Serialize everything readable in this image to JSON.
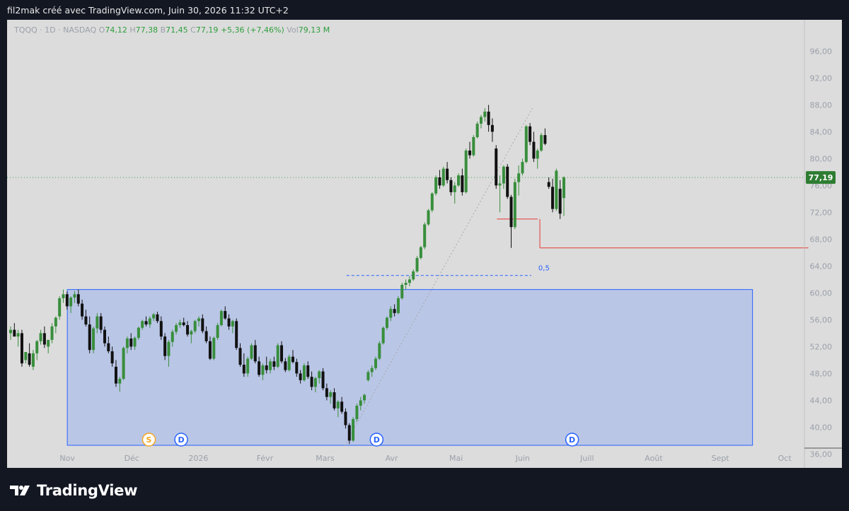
{
  "header": {
    "title": "fil2mak créé avec TradingView.com, Juin 30, 2026 11:32 UTC+2"
  },
  "legend": {
    "symbol": "TQQQ · 1D · NASDAQ",
    "o_label": "O",
    "o_value": "74,12",
    "h_label": "H",
    "h_value": "77,38",
    "l_label": "B",
    "l_value": "71,45",
    "c_label": "C",
    "c_value": "77,19",
    "change": "+5,36 (+7,46%)",
    "vol_label": "Vol",
    "vol_value": "79,13 M"
  },
  "price_label": "77,19",
  "fib_label": "0,5",
  "brand": {
    "name": "TradingView"
  },
  "colors": {
    "up": "#388e3c",
    "down": "#111111",
    "zone_fill": "#b7c4e6",
    "zone_stroke": "#2962ff",
    "support": "#e53935",
    "last_price": "#2e7d32"
  },
  "chart_data": {
    "type": "candlestick",
    "symbol": "TQQQ",
    "interval": "1D",
    "exchange": "NASDAQ",
    "ylim": [
      34,
      98
    ],
    "y_ticks": [
      "96,00",
      "92,00",
      "88,00",
      "84,00",
      "80,00",
      "76,00",
      "72,00",
      "68,00",
      "64,00",
      "60,00",
      "56,00",
      "52,00",
      "48,00",
      "44,00",
      "40,00",
      "36,00"
    ],
    "x_ticks": [
      "Nov",
      "Déc",
      "2026",
      "Févr",
      "Mars",
      "Avr",
      "Mai",
      "Juin",
      "Juill",
      "Août",
      "Sept",
      "Oct"
    ],
    "last_price": 77.19,
    "zone": {
      "date_start": "2025-11-01",
      "date_end": "2026-09-16",
      "price_top": 60.5,
      "price_bottom": 37.3
    },
    "support_lines": [
      {
        "price": 71.0,
        "date_start": "2026-05-20",
        "date_end": "2026-06-08"
      },
      {
        "price": 66.7,
        "date_start": "2026-06-09",
        "date_end": "2026-10-12"
      }
    ],
    "fib_level": {
      "label": "0,5",
      "price": 62.6,
      "date_start": "2026-03-11",
      "date_end": "2026-06-05"
    },
    "trend_line": {
      "from": [
        "2026-03-10",
        37.2
      ],
      "to": [
        "2026-06-06",
        87.8
      ]
    },
    "event_markers": [
      {
        "label": "S",
        "date": "2025-12-09"
      },
      {
        "label": "D",
        "date": "2025-12-24"
      },
      {
        "label": "D",
        "date": "2026-03-25"
      },
      {
        "label": "D",
        "date": "2026-06-24"
      }
    ],
    "candles": [
      [
        54,
        55,
        53,
        54.5
      ],
      [
        54.5,
        55.5,
        53.5,
        53.5
      ],
      [
        53.5,
        54.5,
        52,
        54
      ],
      [
        54,
        54.5,
        49,
        49.5
      ],
      [
        50,
        51,
        49.5,
        51.2
      ],
      [
        51,
        52.5,
        49,
        49.3
      ],
      [
        49,
        51.5,
        48.5,
        51
      ],
      [
        51,
        53,
        50,
        52.8
      ],
      [
        52.8,
        54.5,
        52.3,
        54
      ],
      [
        54,
        55,
        51.8,
        52.3
      ],
      [
        52,
        53,
        51,
        53
      ],
      [
        53,
        55.5,
        52.5,
        55
      ],
      [
        55,
        56.5,
        54,
        56.3
      ],
      [
        56.5,
        59.5,
        56,
        59.2
      ],
      [
        59.2,
        60.5,
        58.5,
        59.8
      ],
      [
        59.8,
        60.2,
        57.5,
        58
      ],
      [
        58,
        59.5,
        57,
        59.3
      ],
      [
        59.3,
        60.3,
        58.5,
        59.8
      ],
      [
        59.8,
        60.5,
        58,
        58.4
      ],
      [
        58.4,
        59,
        56,
        56.5
      ],
      [
        56.5,
        57.5,
        55,
        55.3
      ],
      [
        55.3,
        56.5,
        51,
        51.5
      ],
      [
        51.5,
        55,
        51,
        54.7
      ],
      [
        54.7,
        57,
        54,
        56.5
      ],
      [
        56.5,
        57,
        54,
        54.5
      ],
      [
        54.5,
        55,
        52,
        52.5
      ],
      [
        52.5,
        53.5,
        51,
        51.3
      ],
      [
        51.3,
        52,
        49,
        49.5
      ],
      [
        49,
        50,
        46,
        46.5
      ],
      [
        46.5,
        47.5,
        45.3,
        47.2
      ],
      [
        47.2,
        52,
        47,
        51.8
      ],
      [
        51.8,
        53.5,
        51,
        53.2
      ],
      [
        53.2,
        54,
        51.5,
        52
      ],
      [
        52,
        53.5,
        51.5,
        53.3
      ],
      [
        53.3,
        55,
        53,
        54.8
      ],
      [
        54.8,
        56,
        54.5,
        55.8
      ],
      [
        55.8,
        56.5,
        55,
        55.3
      ],
      [
        55.3,
        56.5,
        54.8,
        56.2
      ],
      [
        56.2,
        57,
        55.8,
        56.8
      ],
      [
        56.8,
        57.2,
        55.5,
        55.8
      ],
      [
        55.8,
        56.5,
        53,
        53.5
      ],
      [
        53.5,
        54,
        50,
        50.6
      ],
      [
        50.6,
        53,
        49,
        52.7
      ],
      [
        52.7,
        54.5,
        52,
        54.2
      ],
      [
        54.2,
        55.5,
        53.8,
        55.2
      ],
      [
        55.2,
        56,
        54.8,
        55.6
      ],
      [
        55.6,
        56.3,
        55,
        55.2
      ],
      [
        55.2,
        55.8,
        53.5,
        53.8
      ],
      [
        53.8,
        54.5,
        52.5,
        54.3
      ],
      [
        54.3,
        56,
        54,
        55.8
      ],
      [
        55.8,
        56.5,
        55,
        56.2
      ],
      [
        56.2,
        56.8,
        54,
        54.3
      ],
      [
        54.3,
        55,
        52.5,
        52.8
      ],
      [
        52.8,
        53.5,
        50,
        50.2
      ],
      [
        50.2,
        53.5,
        50,
        53.3
      ],
      [
        53.3,
        55.5,
        53,
        55.2
      ],
      [
        55.2,
        57.5,
        55,
        57.3
      ],
      [
        57.3,
        58,
        56,
        56.2
      ],
      [
        56.2,
        56.8,
        54.5,
        55
      ],
      [
        55,
        56,
        54,
        55.8
      ],
      [
        55.8,
        56.2,
        51.5,
        51.8
      ],
      [
        51.8,
        52.5,
        49,
        49.3
      ],
      [
        49.3,
        51,
        47.5,
        48
      ],
      [
        48,
        50.5,
        47.5,
        50.2
      ],
      [
        50.2,
        52.5,
        50,
        52.2
      ],
      [
        52.2,
        53,
        49.5,
        49.8
      ],
      [
        49.8,
        50.5,
        47.5,
        47.8
      ],
      [
        47.8,
        49.5,
        47,
        49.2
      ],
      [
        49.2,
        50.5,
        48,
        48.5
      ],
      [
        48.5,
        50.2,
        48,
        49.8
      ],
      [
        49.8,
        50.5,
        48.5,
        49
      ],
      [
        49,
        52.5,
        48.8,
        52.2
      ],
      [
        52.2,
        52.8,
        49.5,
        49.8
      ],
      [
        49.8,
        50.3,
        48.2,
        48.5
      ],
      [
        48.5,
        50.8,
        48.3,
        50.5
      ],
      [
        50.5,
        51.5,
        49.5,
        49.7
      ],
      [
        49.7,
        50.2,
        47.5,
        48
      ],
      [
        48,
        48.5,
        46.5,
        47
      ],
      [
        47,
        49.5,
        46.8,
        49.2
      ],
      [
        49.2,
        49.8,
        47.2,
        47.5
      ],
      [
        47.5,
        48.3,
        45.5,
        46
      ],
      [
        46,
        47.5,
        45.2,
        47.3
      ],
      [
        47.3,
        48.5,
        46.5,
        48.3
      ],
      [
        48.3,
        48.8,
        45.5,
        45.8
      ],
      [
        45.8,
        46.5,
        44,
        44.5
      ],
      [
        44.5,
        45.5,
        43.5,
        45.2
      ],
      [
        45.2,
        45.8,
        42.5,
        42.8
      ],
      [
        42.8,
        44,
        41.5,
        43.8
      ],
      [
        43.8,
        44.5,
        42,
        42.3
      ],
      [
        42.3,
        42.8,
        39.8,
        40.3
      ],
      [
        40.3,
        40.6,
        37.5,
        38
      ],
      [
        38,
        41.5,
        37.8,
        41.2
      ],
      [
        41.2,
        43.5,
        40.8,
        43.2
      ],
      [
        43.2,
        44.5,
        42.5,
        44
      ],
      [
        44,
        45,
        43.5,
        44.8
      ],
      [
        47,
        48.5,
        46.8,
        48.2
      ],
      [
        48.2,
        49.2,
        47.5,
        48.8
      ],
      [
        48.8,
        50.5,
        48.5,
        50.2
      ],
      [
        50.2,
        52.8,
        50,
        52.5
      ],
      [
        52.5,
        55,
        52.3,
        54.8
      ],
      [
        54.8,
        56.5,
        54.5,
        56.3
      ],
      [
        56.3,
        58,
        55.8,
        57.6
      ],
      [
        57.6,
        58.3,
        56.5,
        57
      ],
      [
        57,
        59.5,
        56.8,
        59.2
      ],
      [
        59.2,
        61.5,
        59,
        61.2
      ],
      [
        61.2,
        62,
        60.5,
        61.5
      ],
      [
        61.5,
        62.5,
        61,
        62
      ],
      [
        62,
        63.5,
        61.8,
        63.2
      ],
      [
        63.2,
        65.5,
        63,
        65.2
      ],
      [
        65.2,
        67,
        65,
        66.8
      ],
      [
        66.8,
        70.5,
        66.5,
        70.2
      ],
      [
        70.2,
        72.5,
        70,
        72.3
      ],
      [
        72.3,
        75,
        72,
        74.8
      ],
      [
        74.8,
        77.5,
        74.5,
        77.2
      ],
      [
        77.2,
        78.3,
        75.5,
        76
      ],
      [
        76,
        78.8,
        75.8,
        78.5
      ],
      [
        78.5,
        79.5,
        76.3,
        76.8
      ],
      [
        76.8,
        77.2,
        74.5,
        75
      ],
      [
        75,
        76.5,
        73.3,
        76
      ],
      [
        76,
        77.8,
        75.8,
        77.5
      ],
      [
        77.5,
        78.5,
        74.5,
        75
      ],
      [
        75,
        81.5,
        74.8,
        81.2
      ],
      [
        81.2,
        82.5,
        80,
        80.5
      ],
      [
        80.5,
        83.5,
        80.3,
        83.2
      ],
      [
        83.2,
        85.5,
        83,
        85.2
      ],
      [
        85.2,
        86.5,
        84.5,
        86.2
      ],
      [
        86.2,
        87.5,
        85.5,
        87
      ],
      [
        87,
        88,
        84,
        85
      ],
      [
        85,
        86,
        82.5,
        84
      ],
      [
        81.5,
        82,
        75.5,
        76
      ],
      [
        76,
        77.5,
        72,
        76.3
      ],
      [
        76.3,
        79,
        75.5,
        78.8
      ],
      [
        78.8,
        79.2,
        74,
        74.3
      ],
      [
        74.3,
        74.6,
        66.7,
        69.8
      ],
      [
        69.8,
        77,
        69.5,
        76.5
      ],
      [
        76.5,
        79,
        74.5,
        77.8
      ],
      [
        77.8,
        80,
        77.5,
        79.5
      ],
      [
        79.5,
        85,
        79.3,
        84.8
      ],
      [
        84.8,
        85.3,
        82,
        82.5
      ],
      [
        82.5,
        84,
        79.5,
        80
      ],
      [
        80,
        81.5,
        78.5,
        81.2
      ],
      [
        81.2,
        83.8,
        81,
        83.5
      ],
      [
        83.5,
        84.5,
        82,
        82.2
      ],
      [
        76.5,
        77.2,
        75.5,
        75.8
      ],
      [
        75.8,
        77,
        72,
        72.5
      ],
      [
        72.5,
        78.5,
        72.2,
        78.2
      ],
      [
        75.5,
        76.8,
        71,
        71.8
      ],
      [
        74.12,
        77.38,
        71.45,
        77.19
      ]
    ]
  }
}
